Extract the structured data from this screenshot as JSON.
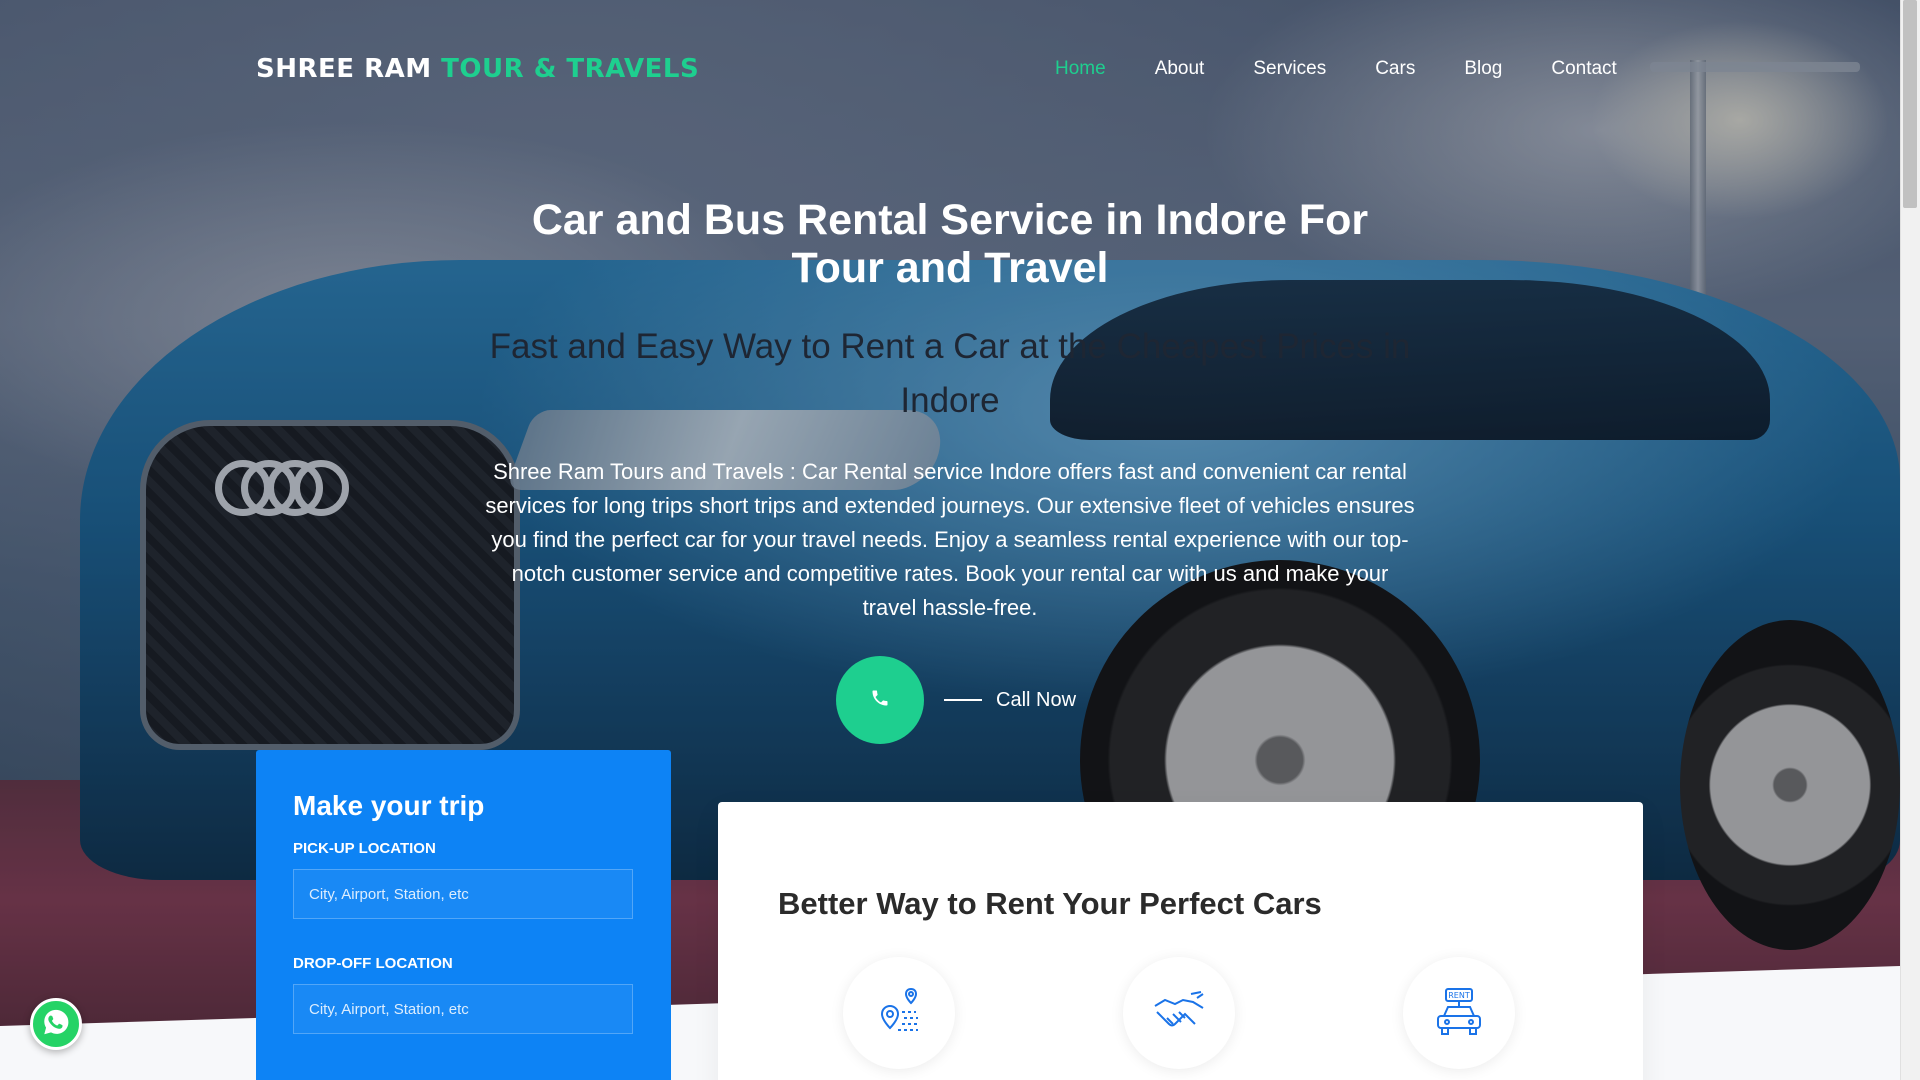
{
  "brand": {
    "name_part1": "SHREE RAM",
    "name_part2": "TOUR & TRAVELS"
  },
  "nav": {
    "items": [
      {
        "label": "Home",
        "active": true
      },
      {
        "label": "About"
      },
      {
        "label": "Services"
      },
      {
        "label": "Cars"
      },
      {
        "label": "Blog"
      },
      {
        "label": "Contact"
      }
    ]
  },
  "hero": {
    "title": "Car and Bus Rental Service in Indore For Tour and Travel",
    "subtitle": "Fast and Easy Way to Rent a Car at the Cheapest Prices in Indore",
    "description": "Shree Ram Tours and Travels : Car Rental service Indore offers fast and convenient car rental services for long trips short trips and extended journeys. Our extensive fleet of vehicles ensures you find the perfect car for your travel needs. Enjoy a seamless rental experience with our top-notch customer service and competitive rates. Book your rental car with us and make your travel hassle-free.",
    "call_label": "Call Now",
    "call_icon": "phone-icon"
  },
  "trip_form": {
    "title": "Make your trip",
    "pickup_label": "PICK-UP LOCATION",
    "pickup_placeholder": "City, Airport, Station, etc",
    "dropoff_label": "DROP-OFF LOCATION",
    "dropoff_placeholder": "City, Airport, Station, etc"
  },
  "services_card": {
    "title": "Better Way to Rent Your Perfect Cars",
    "icons": [
      "route-map-icon",
      "handshake-icon",
      "rent-car-icon"
    ]
  },
  "whatsapp": {
    "icon": "whatsapp-icon"
  },
  "colors": {
    "accent_green": "#1ecf8f",
    "form_blue": "#0d83f5",
    "icon_blue": "#1a73e8"
  }
}
